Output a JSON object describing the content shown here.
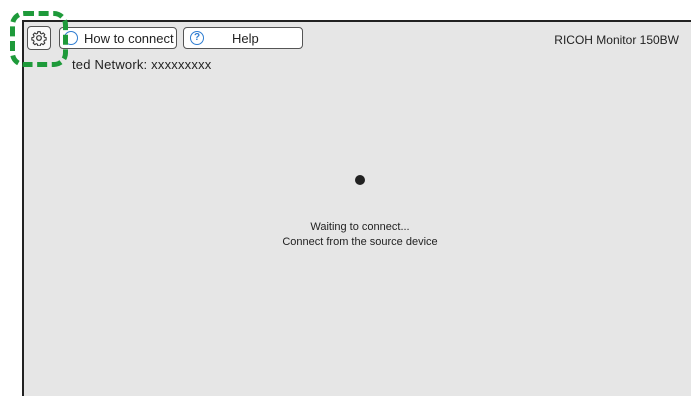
{
  "toolbar": {
    "settings_icon": "gear-icon",
    "how_to_connect_label": "How to connect",
    "help_label": "Help",
    "highlight_color": "#1e9a3a"
  },
  "network": {
    "label": "ted Network: xxxxxxxxx"
  },
  "device": {
    "name": "RICOH Monitor 150BW"
  },
  "status": {
    "line1": "Waiting to connect...",
    "line2": "Connect from the source device"
  }
}
